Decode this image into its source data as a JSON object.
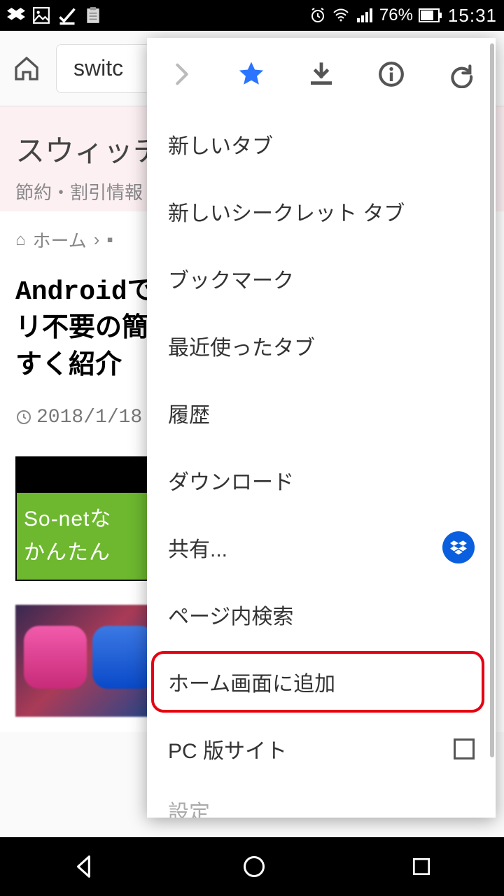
{
  "status": {
    "battery_pct": "76%",
    "time": "15:31"
  },
  "toolbar": {
    "url_fragment": "switc"
  },
  "page": {
    "site_title": "スウィッチ",
    "site_sub": "節約・割引情報",
    "breadcrumb_home": "ホーム",
    "article_title_line1": "Androidで",
    "article_title_line2": "リ不要の簡",
    "article_title_line3": "すく紹介",
    "date": "2018/1/18",
    "banner_line1": "So-netな",
    "banner_line2": "かんたん"
  },
  "menu": {
    "items": [
      "新しいタブ",
      "新しいシークレット タブ",
      "ブックマーク",
      "最近使ったタブ",
      "履歴",
      "ダウンロード",
      "共有...",
      "ページ内検索",
      "ホーム画面に追加",
      "PC 版サイト",
      "設定"
    ]
  }
}
